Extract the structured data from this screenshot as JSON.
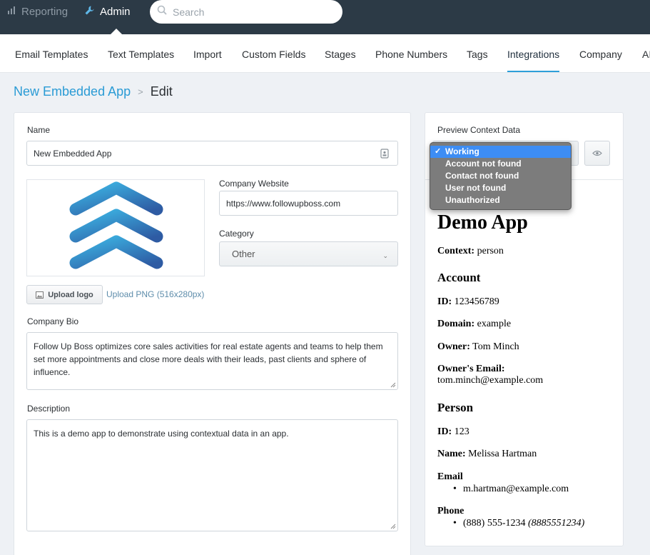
{
  "topbar": {
    "reporting": "Reporting",
    "admin": "Admin",
    "search_placeholder": "Search"
  },
  "nav": {
    "tabs": [
      "Email Templates",
      "Text Templates",
      "Import",
      "Custom Fields",
      "Stages",
      "Phone Numbers",
      "Tags",
      "Integrations",
      "Company",
      "AI"
    ],
    "active": "Integrations"
  },
  "breadcrumb": {
    "parent": "New Embedded App",
    "separator": ">",
    "current": "Edit"
  },
  "form": {
    "name_label": "Name",
    "name_value": "New Embedded App",
    "website_label": "Company Website",
    "website_value": "https://www.followupboss.com",
    "category_label": "Category",
    "category_value": "Other",
    "upload_label": "Upload logo",
    "upload_hint": "Upload PNG (516x280px)",
    "bio_label": "Company Bio",
    "bio_value": "Follow Up Boss optimizes core sales activities for real estate agents and teams to help them set more appointments and close more deals with their leads, past clients and sphere of influence.",
    "description_label": "Description",
    "description_value": "This is a demo app to demonstrate using contextual data in an app."
  },
  "preview": {
    "label": "Preview Context Data",
    "options": [
      "Working",
      "Account not found",
      "Contact not found",
      "User not found",
      "Unauthorized"
    ],
    "selected": "Working",
    "check": "✓",
    "title": "Demo App",
    "context_label": "Context:",
    "context_value": "person",
    "account_heading": "Account",
    "id_label": "ID:",
    "account_id": "123456789",
    "domain_label": "Domain:",
    "domain_value": "example",
    "owner_label": "Owner:",
    "owner_value": "Tom Minch",
    "owner_email_label": "Owner's Email:",
    "owner_email_value": "tom.minch@example.com",
    "person_heading": "Person",
    "person_id": "123",
    "name_label": "Name:",
    "person_name": "Melissa Hartman",
    "email_heading": "Email",
    "person_email": "m.hartman@example.com",
    "phone_heading": "Phone",
    "person_phone": "(888) 555-1234",
    "person_phone_raw": "(8885551234)"
  },
  "colors": {
    "topbar": "#2c3a46",
    "accent": "#2a9bd5",
    "dropdown_selected": "#3d8df4"
  }
}
